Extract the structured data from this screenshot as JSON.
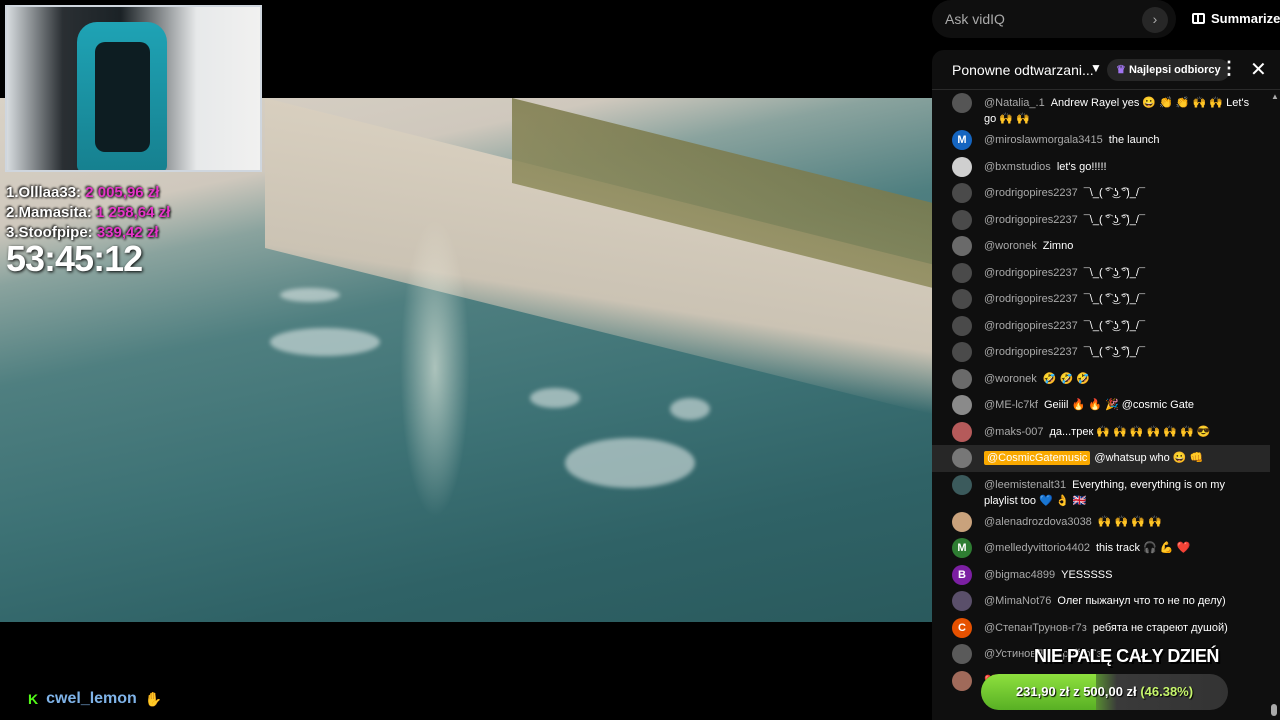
{
  "stream": {
    "leaderboard": [
      {
        "rank": "1.",
        "name": "Olllaa33:",
        "amount": "2 005,96 zł"
      },
      {
        "rank": "2.",
        "name": "Mamasita:",
        "amount": "1 258,64 zł"
      },
      {
        "rank": "3.",
        "name": "Stoofpipe:",
        "amount": "339,42 zł"
      }
    ],
    "timer": "53:45:12",
    "kick_logo": "K",
    "streamer_name": "cwel_lemon"
  },
  "top_bar": {
    "ask_placeholder": "Ask vidIQ",
    "ask_go_icon": "›",
    "summarize_label": "Summarize"
  },
  "chat": {
    "title": "Ponowne odtwarzani...",
    "badge_label": "Najlepsi odbiorcy",
    "messages": [
      {
        "author": "@Natalia_.1",
        "text": "Andrew Rayel yes 😀 👏 👏 🙌 🙌 Let's go 🙌 🙌",
        "avatar_color": "#555555",
        "initial": ""
      },
      {
        "author": "@miroslawmorgala3415",
        "text": "the launch",
        "avatar_color": "#1565c0",
        "initial": "M"
      },
      {
        "author": "@bxmstudios",
        "text": "let's go!!!!!",
        "avatar_color": "#cfcfcf",
        "initial": ""
      },
      {
        "author": "@rodrigopires2237",
        "text": "¯\\_( ͡° ͜ʖ ͡°)_/¯",
        "avatar_color": "#4a4a4a",
        "initial": ""
      },
      {
        "author": "@rodrigopires2237",
        "text": "¯\\_( ͡° ͜ʖ ͡°)_/¯",
        "avatar_color": "#4a4a4a",
        "initial": ""
      },
      {
        "author": "@woronek",
        "text": "Zimno",
        "avatar_color": "#6a6a6a",
        "initial": ""
      },
      {
        "author": "@rodrigopires2237",
        "text": "¯\\_( ͡° ͜ʖ ͡°)_/¯",
        "avatar_color": "#4a4a4a",
        "initial": ""
      },
      {
        "author": "@rodrigopires2237",
        "text": "¯\\_( ͡° ͜ʖ ͡°)_/¯",
        "avatar_color": "#4a4a4a",
        "initial": ""
      },
      {
        "author": "@rodrigopires2237",
        "text": "¯\\_( ͡° ͜ʖ ͡°)_/¯",
        "avatar_color": "#4a4a4a",
        "initial": ""
      },
      {
        "author": "@rodrigopires2237",
        "text": "¯\\_( ͡° ͜ʖ ͡°)_/¯",
        "avatar_color": "#4a4a4a",
        "initial": ""
      },
      {
        "author": "@woronek",
        "text": "🤣 🤣 🤣",
        "avatar_color": "#6a6a6a",
        "initial": ""
      },
      {
        "author": "@ME-lc7kf",
        "text": "Geiiil 🔥 🔥 🎉 @cosmic Gate",
        "avatar_color": "#8a8a8a",
        "initial": ""
      },
      {
        "author": "@maks-007",
        "text": "да...трек 🙌 🙌 🙌 🙌 🙌 🙌 😎",
        "avatar_color": "#b55a5a",
        "initial": ""
      },
      {
        "author": "",
        "mention": "@CosmicGatemusic",
        "text": "@whatsup who 😀 👊",
        "avatar_color": "#777777",
        "initial": "",
        "highlight": true
      },
      {
        "author": "@leemistenalt31",
        "text": "Everything, everything is on my playlist too 💙 👌 🇬🇧",
        "avatar_color": "#3b5a5c",
        "initial": ""
      },
      {
        "author": "@alenadrozdova3038",
        "text": "🙌 🙌 🙌 🙌",
        "avatar_color": "#c9a27c",
        "initial": ""
      },
      {
        "author": "@melledyvittorio4402",
        "text": "this track 🎧 💪 ❤️",
        "avatar_color": "#2e7d32",
        "initial": "M"
      },
      {
        "author": "@bigmac4899",
        "text": "YESSSSS",
        "avatar_color": "#7b1fa2",
        "initial": "B"
      },
      {
        "author": "@MimaNot76",
        "text": "Олег пыжанул что то не по делу)",
        "avatar_color": "#5a4f6a",
        "initial": ""
      },
      {
        "author": "@СтепанТрунов-г7з",
        "text": "ребята не стареют душой)",
        "avatar_color": "#e65100",
        "initial": "C"
      },
      {
        "author": "@УстиновДмитрий-р7з",
        "text": "",
        "avatar_color": "#5a5a5a",
        "initial": ""
      },
      {
        "author": "",
        "text": "❤️ ❤️ ❤️ ❤️",
        "avatar_color": "#a06a5a",
        "initial": ""
      }
    ]
  },
  "overlay": {
    "goal_title": "NIE PALĘ CAŁY DZIEŃ",
    "goal_current": "231,90 zł",
    "goal_sep": "z",
    "goal_target": "500,00 zł",
    "goal_percent_label": "(46.38%)",
    "goal_fraction": 0.4638
  },
  "colors": {
    "donation_amount": "#e535c8",
    "chat_bg": "#0f0f0f",
    "goal_green": "#6fd02b",
    "mention_bg": "#f9a900"
  },
  "icons": [
    "chevron-right-icon",
    "book-icon",
    "chevron-down-icon",
    "crown-icon",
    "more-vert-icon",
    "close-icon",
    "kick-logo-icon",
    "hand-icon",
    "scroll-up-icon"
  ]
}
